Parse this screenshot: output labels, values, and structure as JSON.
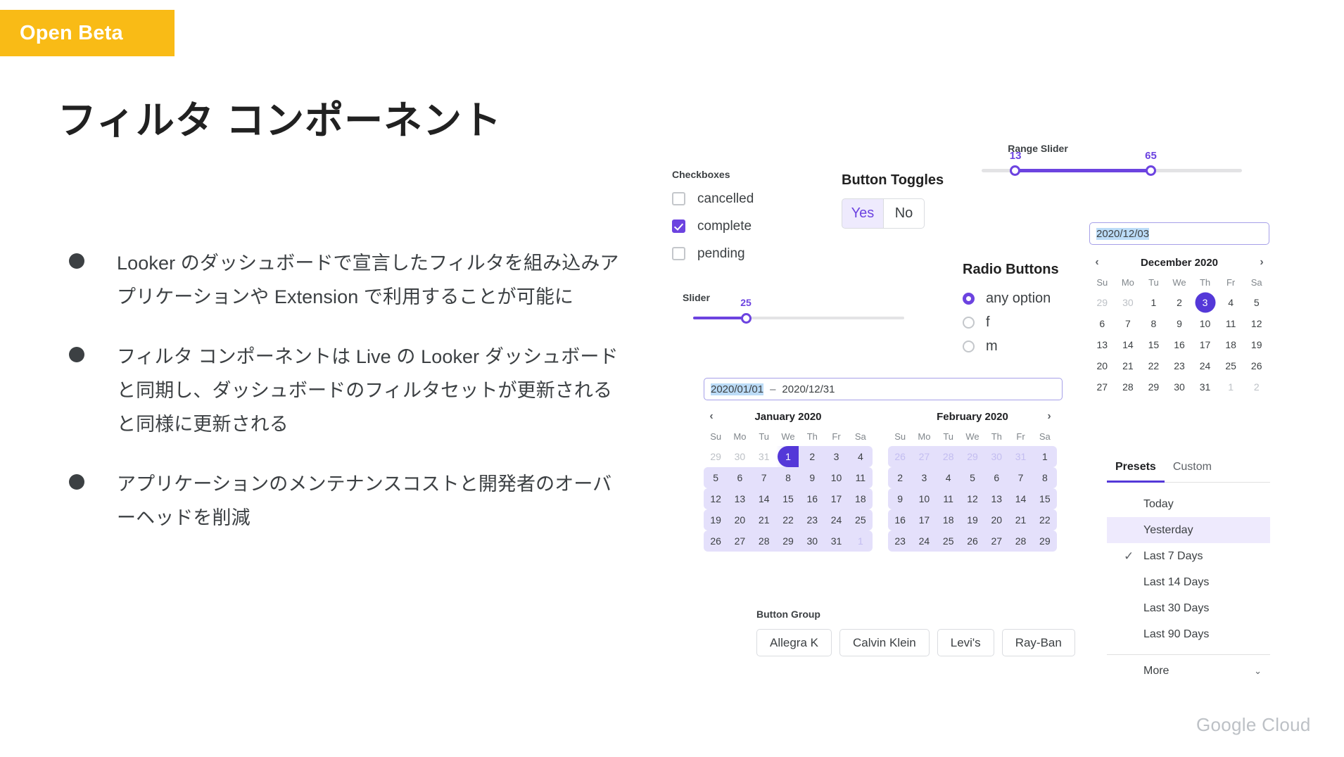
{
  "badge": {
    "label": "Open Beta"
  },
  "title": "フィルタ コンポーネント",
  "bullets": [
    "Looker のダッシュボードで宣言したフィルタを組み込みアプリケーションや Extension で利用することが可能に",
    "フィルタ コンポーネントは Live の Looker ダッシュボードと同期し、ダッシュボードのフィルタセットが更新されると同様に更新される",
    "アプリケーションのメンテナンスコストと開発者のオーバーヘッドを削減"
  ],
  "colors": {
    "accent_purple": "#6c43e0",
    "accent_purple_dark": "#5438d8",
    "accent_purple_light": "#eeeafd",
    "range_fill": "#e4e0fb",
    "badge_yellow": "#f9bb16",
    "text_selection_blue": "#bcdcf7"
  },
  "checkboxes": {
    "label": "Checkboxes",
    "items": [
      {
        "label": "cancelled",
        "checked": false
      },
      {
        "label": "complete",
        "checked": true
      },
      {
        "label": "pending",
        "checked": false
      }
    ]
  },
  "slider": {
    "label": "Slider",
    "value": 25,
    "min": 0,
    "max": 100
  },
  "button_toggles": {
    "label": "Button Toggles",
    "options": [
      {
        "label": "Yes",
        "selected": true
      },
      {
        "label": "No",
        "selected": false
      }
    ]
  },
  "range_slider": {
    "label": "Range Slider",
    "low": 13,
    "high": 65,
    "min": 0,
    "max": 100
  },
  "radio_buttons": {
    "label": "Radio Buttons",
    "options": [
      {
        "label": "any option",
        "selected": true
      },
      {
        "label": "f",
        "selected": false
      },
      {
        "label": "m",
        "selected": false
      }
    ]
  },
  "date_picker": {
    "input_value": "2020/12/03",
    "month_title": "December 2020",
    "prev_icon": "‹",
    "next_icon": "›",
    "dow": [
      "Su",
      "Mo",
      "Tu",
      "We",
      "Th",
      "Fr",
      "Sa"
    ],
    "weeks": [
      [
        {
          "d": "29",
          "mute": true
        },
        {
          "d": "30",
          "mute": true
        },
        {
          "d": "1"
        },
        {
          "d": "2"
        },
        {
          "d": "3",
          "selected": true
        },
        {
          "d": "4"
        },
        {
          "d": "5"
        }
      ],
      [
        {
          "d": "6"
        },
        {
          "d": "7"
        },
        {
          "d": "8"
        },
        {
          "d": "9"
        },
        {
          "d": "10"
        },
        {
          "d": "11"
        },
        {
          "d": "12"
        }
      ],
      [
        {
          "d": "13"
        },
        {
          "d": "14"
        },
        {
          "d": "15"
        },
        {
          "d": "16"
        },
        {
          "d": "17"
        },
        {
          "d": "18"
        },
        {
          "d": "19"
        }
      ],
      [
        {
          "d": "20"
        },
        {
          "d": "21"
        },
        {
          "d": "22"
        },
        {
          "d": "23"
        },
        {
          "d": "24"
        },
        {
          "d": "25"
        },
        {
          "d": "26"
        }
      ],
      [
        {
          "d": "27"
        },
        {
          "d": "28"
        },
        {
          "d": "29"
        },
        {
          "d": "30"
        },
        {
          "d": "31"
        },
        {
          "d": "1",
          "mute": true
        },
        {
          "d": "2",
          "mute": true
        }
      ]
    ]
  },
  "date_range_picker": {
    "start_value": "2020/01/01",
    "separator": "–",
    "end_value": "2020/12/31",
    "prev_icon": "‹",
    "next_icon": "›",
    "dow": [
      "Su",
      "Mo",
      "Tu",
      "We",
      "Th",
      "Fr",
      "Sa"
    ],
    "left": {
      "month_title": "January 2020",
      "weeks": [
        [
          {
            "d": "29",
            "mute": true
          },
          {
            "d": "30",
            "mute": true
          },
          {
            "d": "31",
            "mute": true
          },
          {
            "d": "1",
            "rangeStart": true
          },
          {
            "d": "2",
            "inRange": true
          },
          {
            "d": "3",
            "inRange": true
          },
          {
            "d": "4",
            "inRange": true,
            "roundR": true
          }
        ],
        [
          {
            "d": "5",
            "inRange": true,
            "roundL": true
          },
          {
            "d": "6",
            "inRange": true
          },
          {
            "d": "7",
            "inRange": true
          },
          {
            "d": "8",
            "inRange": true
          },
          {
            "d": "9",
            "inRange": true
          },
          {
            "d": "10",
            "inRange": true
          },
          {
            "d": "11",
            "inRange": true,
            "roundR": true
          }
        ],
        [
          {
            "d": "12",
            "inRange": true,
            "roundL": true
          },
          {
            "d": "13",
            "inRange": true
          },
          {
            "d": "14",
            "inRange": true
          },
          {
            "d": "15",
            "inRange": true
          },
          {
            "d": "16",
            "inRange": true
          },
          {
            "d": "17",
            "inRange": true
          },
          {
            "d": "18",
            "inRange": true,
            "roundR": true
          }
        ],
        [
          {
            "d": "19",
            "inRange": true,
            "roundL": true
          },
          {
            "d": "20",
            "inRange": true
          },
          {
            "d": "21",
            "inRange": true
          },
          {
            "d": "22",
            "inRange": true
          },
          {
            "d": "23",
            "inRange": true
          },
          {
            "d": "24",
            "inRange": true
          },
          {
            "d": "25",
            "inRange": true,
            "roundR": true
          }
        ],
        [
          {
            "d": "26",
            "inRange": true,
            "roundL": true
          },
          {
            "d": "27",
            "inRange": true
          },
          {
            "d": "28",
            "inRange": true
          },
          {
            "d": "29",
            "inRange": true
          },
          {
            "d": "30",
            "inRange": true
          },
          {
            "d": "31",
            "inRange": true
          },
          {
            "d": "1",
            "inRange": true,
            "rangeMute": true,
            "roundR": true
          }
        ]
      ]
    },
    "right": {
      "month_title": "February 2020",
      "weeks": [
        [
          {
            "d": "26",
            "inRange": true,
            "rangeMute": true,
            "roundL": true
          },
          {
            "d": "27",
            "inRange": true,
            "rangeMute": true
          },
          {
            "d": "28",
            "inRange": true,
            "rangeMute": true
          },
          {
            "d": "29",
            "inRange": true,
            "rangeMute": true
          },
          {
            "d": "30",
            "inRange": true,
            "rangeMute": true
          },
          {
            "d": "31",
            "inRange": true,
            "rangeMute": true
          },
          {
            "d": "1",
            "inRange": true,
            "roundR": true
          }
        ],
        [
          {
            "d": "2",
            "inRange": true,
            "roundL": true
          },
          {
            "d": "3",
            "inRange": true
          },
          {
            "d": "4",
            "inRange": true
          },
          {
            "d": "5",
            "inRange": true
          },
          {
            "d": "6",
            "inRange": true
          },
          {
            "d": "7",
            "inRange": true
          },
          {
            "d": "8",
            "inRange": true,
            "roundR": true
          }
        ],
        [
          {
            "d": "9",
            "inRange": true,
            "roundL": true
          },
          {
            "d": "10",
            "inRange": true
          },
          {
            "d": "11",
            "inRange": true
          },
          {
            "d": "12",
            "inRange": true
          },
          {
            "d": "13",
            "inRange": true
          },
          {
            "d": "14",
            "inRange": true
          },
          {
            "d": "15",
            "inRange": true,
            "roundR": true
          }
        ],
        [
          {
            "d": "16",
            "inRange": true,
            "roundL": true
          },
          {
            "d": "17",
            "inRange": true
          },
          {
            "d": "18",
            "inRange": true
          },
          {
            "d": "19",
            "inRange": true
          },
          {
            "d": "20",
            "inRange": true
          },
          {
            "d": "21",
            "inRange": true
          },
          {
            "d": "22",
            "inRange": true,
            "roundR": true
          }
        ],
        [
          {
            "d": "23",
            "inRange": true,
            "roundL": true
          },
          {
            "d": "24",
            "inRange": true
          },
          {
            "d": "25",
            "inRange": true
          },
          {
            "d": "26",
            "inRange": true
          },
          {
            "d": "27",
            "inRange": true
          },
          {
            "d": "28",
            "inRange": true
          },
          {
            "d": "29",
            "inRange": true,
            "roundR": true
          }
        ]
      ]
    }
  },
  "button_group": {
    "label": "Button Group",
    "buttons": [
      "Allegra K",
      "Calvin Klein",
      "Levi's",
      "Ray-Ban"
    ]
  },
  "presets_panel": {
    "tabs": [
      {
        "label": "Presets",
        "active": true
      },
      {
        "label": "Custom",
        "active": false
      }
    ],
    "items": [
      {
        "label": "Today",
        "checked": false,
        "highlighted": false
      },
      {
        "label": "Yesterday",
        "checked": false,
        "highlighted": true
      },
      {
        "label": "Last 7 Days",
        "checked": true,
        "highlighted": false
      },
      {
        "label": "Last 14 Days",
        "checked": false,
        "highlighted": false
      },
      {
        "label": "Last 30 Days",
        "checked": false,
        "highlighted": false
      },
      {
        "label": "Last 90 Days",
        "checked": false,
        "highlighted": false
      }
    ],
    "check_icon": "✓",
    "more_label": "More",
    "chevron_icon": "⌄"
  },
  "footer": {
    "logo_text": "Google Cloud"
  }
}
